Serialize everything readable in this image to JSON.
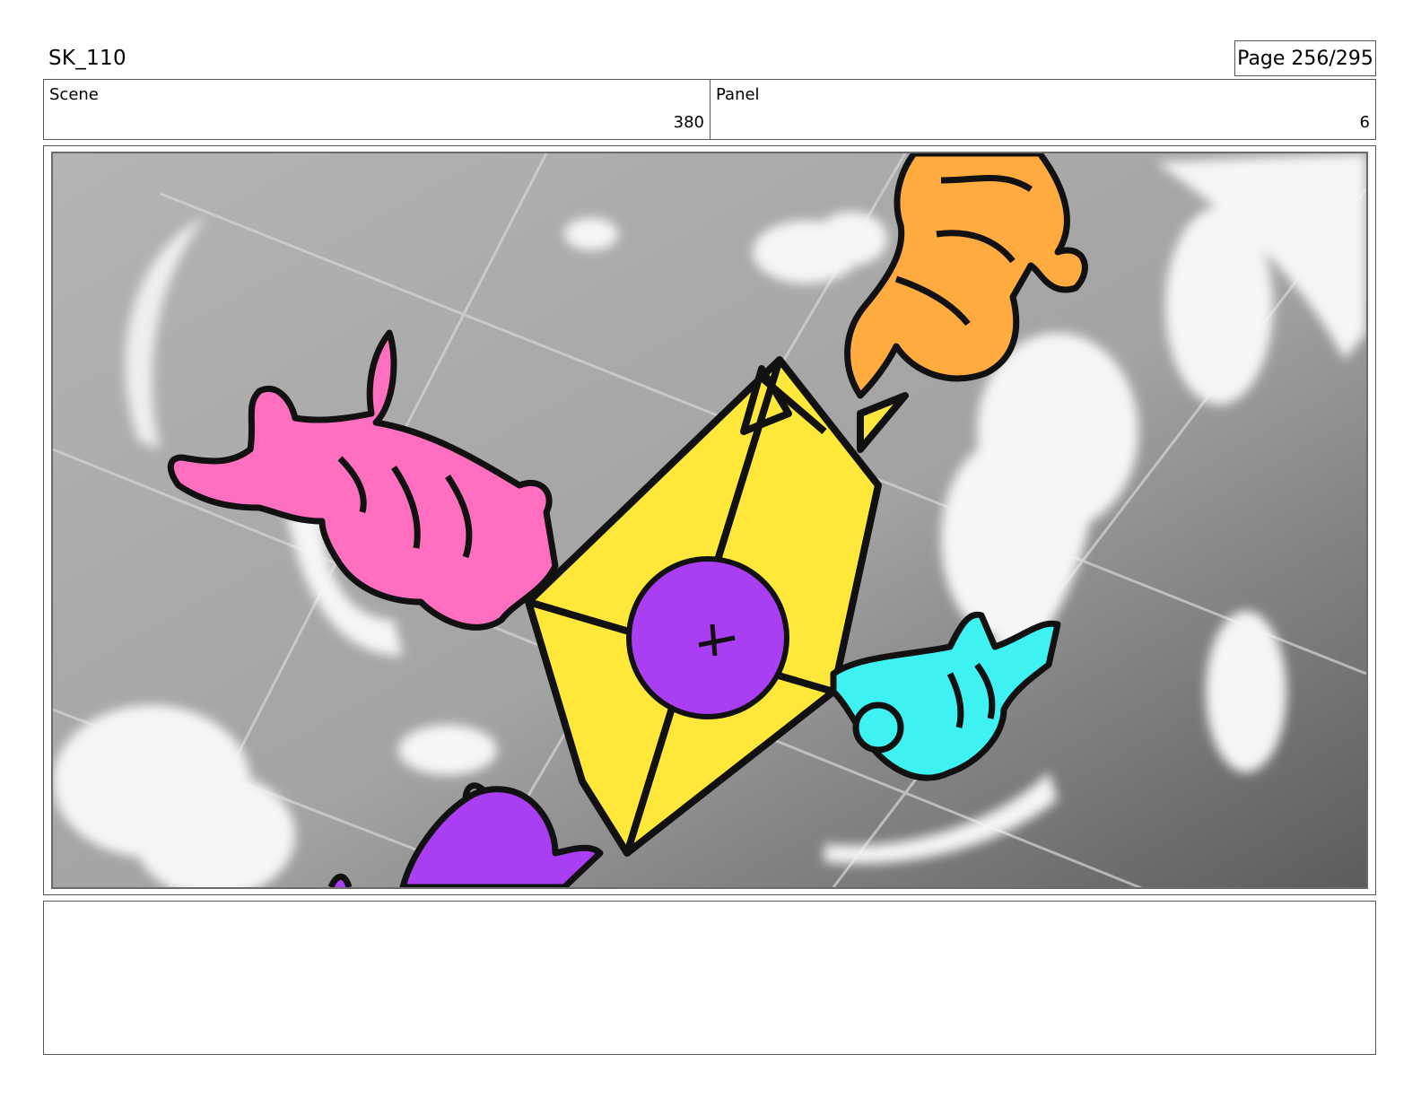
{
  "header": {
    "title": "SK_110",
    "page": "Page 256/295"
  },
  "info": {
    "scene_label": "Scene",
    "scene_value": "380",
    "panel_label": "Panel",
    "panel_value": "6"
  },
  "colors": {
    "pink": "#ff6fbf",
    "orange": "#ffab3f",
    "yellow": "#ffe83a",
    "purple": "#aa3ef2",
    "cyan": "#3ef2f2",
    "sky": "#a8a8a8"
  },
  "notes": {
    "text": ""
  }
}
